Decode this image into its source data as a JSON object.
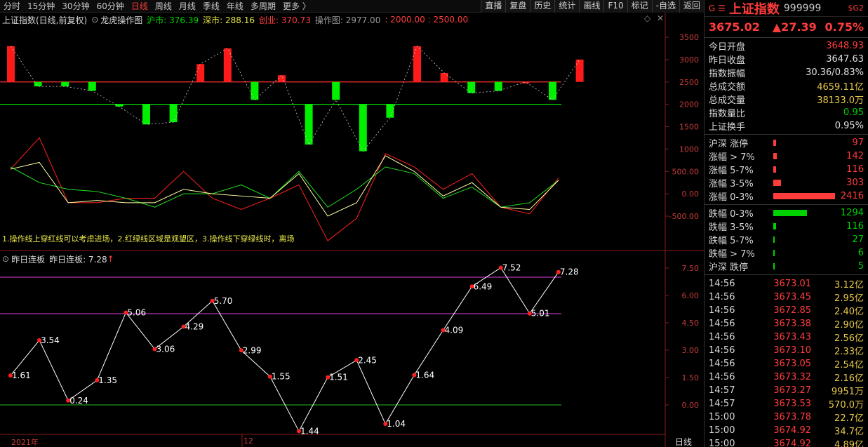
{
  "toolbar": {
    "periods": [
      "分时",
      "15分钟",
      "30分钟",
      "60分钟",
      "日线",
      "周线",
      "月线",
      "季线",
      "年线",
      "多周期",
      "更多 〉"
    ],
    "active_period": "日线",
    "right_buttons": [
      "直播",
      "复盘",
      "历史",
      "统计",
      "画线",
      "F10",
      "标记",
      "-自选",
      "返回"
    ]
  },
  "upper_panel": {
    "index_label": "上证指数(日线,前复权)",
    "indicator_name": "龙虎操作图",
    "sh_label": "沪市: 376.39",
    "sz_label": "深市: 288.16",
    "cy_label": "创业: 370.73",
    "op_label": "操作图: 2977.00",
    "lines_label": ": 2000.00 : 2500.00",
    "note": "1.操作线上穿红线可以考虑进场，2.红绿线区域是观望区，3.操作线下穿绿线时，离场",
    "axis_labels": [
      "3500",
      "3000",
      "2500",
      "2000",
      "1500",
      "1000",
      "500.00",
      "0.00",
      "-500.00"
    ],
    "axis_values": [
      3500,
      3000,
      2500,
      2000,
      1500,
      1000,
      500,
      0,
      -500
    ],
    "red_line": 2500,
    "green_line": 2000
  },
  "lower_panel": {
    "title": "昨日连板",
    "value_label": "昨日连板: 7.28",
    "axis_labels": [
      "7.50",
      "6.00",
      "4.50",
      "3.00",
      "1.50",
      "0.00"
    ],
    "axis_values": [
      7.5,
      6.0,
      4.5,
      3.0,
      1.5,
      0.0
    ],
    "magenta_lines": [
      7.0,
      5.0
    ],
    "green_line": 0
  },
  "xaxis": {
    "left_label": "2021年",
    "mid_label": "12",
    "period_label": "日线"
  },
  "chart_data": {
    "type": "bar",
    "op_bars": [
      3300,
      2400,
      2400,
      2300,
      1950,
      1550,
      1600,
      2900,
      3250,
      2100,
      2650,
      1100,
      2100,
      950,
      1700,
      3300,
      2700,
      2250,
      2300,
      2500,
      2100,
      3000
    ],
    "line_white": [
      550,
      700,
      -200,
      -150,
      -200,
      -200,
      100,
      0,
      -50,
      -100,
      450,
      -500,
      -200,
      850,
      500,
      -50,
      250,
      -300,
      -350,
      300
    ],
    "line_green": [
      600,
      250,
      100,
      50,
      -100,
      -300,
      0,
      0,
      200,
      -100,
      500,
      -300,
      100,
      600,
      450,
      -100,
      150,
      -300,
      -200,
      300
    ],
    "line_red": [
      550,
      1250,
      -200,
      -200,
      -100,
      -100,
      500,
      -100,
      -350,
      -100,
      200,
      -1050,
      -550,
      900,
      600,
      100,
      450,
      -300,
      -450,
      350
    ],
    "lianban": [
      1.61,
      3.54,
      0.24,
      1.35,
      5.06,
      3.06,
      4.29,
      5.7,
      2.99,
      1.55,
      -1.44,
      1.51,
      2.45,
      -1.04,
      1.64,
      4.09,
      6.49,
      7.52,
      5.01,
      7.28
    ],
    "lianban_labels": [
      "1.61",
      "3.54",
      "0.24",
      "1.35",
      "5.06",
      "3.06",
      "4.29",
      "5.70",
      "2.99",
      "1.55",
      "1.44",
      "1.51",
      "2.45",
      "1.04",
      "1.64",
      "4.09",
      "6.49",
      "7.52",
      "5.01",
      "7.28"
    ]
  },
  "info": {
    "g_mark": "G ☰",
    "name": "上证指数",
    "code": "999999",
    "s2": "$G2",
    "price": "3675.02",
    "change": "▲27.39",
    "pct": "0.75%",
    "stats": [
      {
        "label": "今日开盘",
        "value": "3648.93",
        "color": "red"
      },
      {
        "label": "昨日收盘",
        "value": "3647.63",
        "color": "white"
      },
      {
        "label": "指数振幅",
        "value": "30.36/0.83%",
        "color": "white"
      },
      {
        "label": "总成交额",
        "value": "4659.11亿",
        "color": "yellow"
      },
      {
        "label": "总成交量",
        "value": "38133.0万",
        "color": "yellow"
      },
      {
        "label": "指数量比",
        "value": "0.95",
        "color": "green"
      },
      {
        "label": "上证换手",
        "value": "0.95%",
        "color": "white"
      }
    ],
    "up_dist": [
      {
        "label": "沪深 涨停",
        "value": "97",
        "bar": 0.04
      },
      {
        "label": "涨幅 > 7%",
        "value": "142",
        "bar": 0.06
      },
      {
        "label": "涨幅 5-7%",
        "value": "116",
        "bar": 0.05
      },
      {
        "label": "涨幅 3-5%",
        "value": "303",
        "bar": 0.13
      },
      {
        "label": "涨幅 0-3%",
        "value": "2416",
        "bar": 1.0
      }
    ],
    "down_dist": [
      {
        "label": "跌幅 0-3%",
        "value": "1294",
        "bar": 0.54
      },
      {
        "label": "跌幅 3-5%",
        "value": "116",
        "bar": 0.05
      },
      {
        "label": "跌幅 5-7%",
        "value": "27",
        "bar": 0.012
      },
      {
        "label": "跌幅 > 7%",
        "value": "6",
        "bar": 0.005
      },
      {
        "label": "沪深 跌停",
        "value": "5",
        "bar": 0.005
      }
    ],
    "ticks": [
      {
        "t": "14:56",
        "p": "3673.01",
        "v": "3.12亿"
      },
      {
        "t": "14:56",
        "p": "3673.45",
        "v": "2.95亿"
      },
      {
        "t": "14:56",
        "p": "3672.85",
        "v": "2.40亿"
      },
      {
        "t": "14:56",
        "p": "3673.38",
        "v": "2.90亿"
      },
      {
        "t": "14:56",
        "p": "3673.43",
        "v": "2.56亿"
      },
      {
        "t": "14:56",
        "p": "3673.10",
        "v": "2.33亿"
      },
      {
        "t": "14:56",
        "p": "3673.05",
        "v": "2.54亿"
      },
      {
        "t": "14:56",
        "p": "3673.32",
        "v": "2.16亿"
      },
      {
        "t": "14:57",
        "p": "3673.27",
        "v": "9951万"
      },
      {
        "t": "14:57",
        "p": "3673.53",
        "v": "570.0万"
      },
      {
        "t": "15:00",
        "p": "3673.78",
        "v": "22.7亿"
      },
      {
        "t": "15:00",
        "p": "3674.92",
        "v": "34.7亿"
      },
      {
        "t": "15:00",
        "p": "3674.92",
        "v": "4.89亿"
      }
    ]
  }
}
